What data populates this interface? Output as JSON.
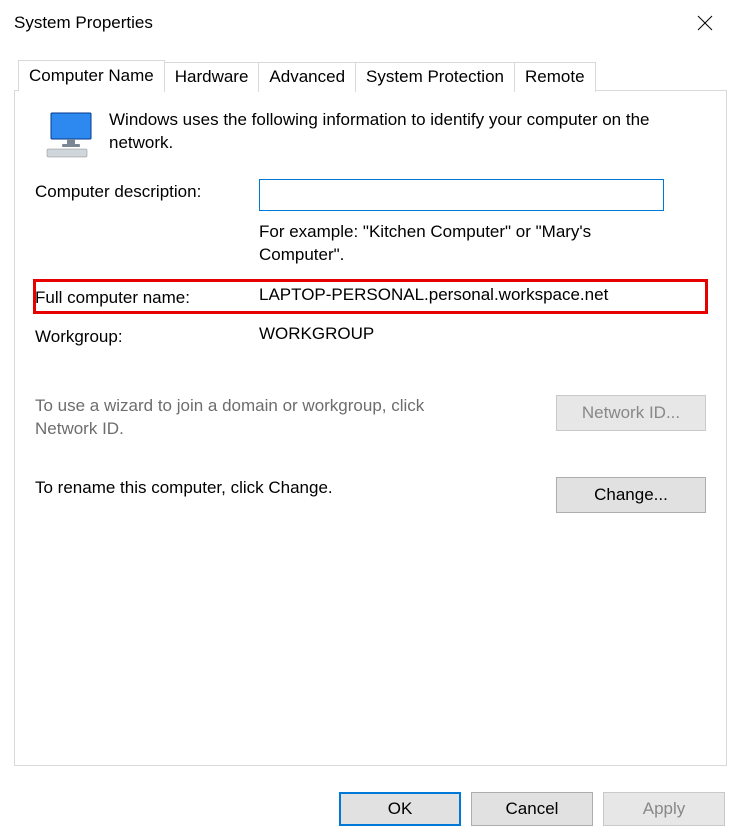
{
  "window": {
    "title": "System Properties"
  },
  "tabs": [
    {
      "label": "Computer Name",
      "active": true
    },
    {
      "label": "Hardware",
      "active": false
    },
    {
      "label": "Advanced",
      "active": false
    },
    {
      "label": "System Protection",
      "active": false
    },
    {
      "label": "Remote",
      "active": false
    }
  ],
  "panel": {
    "intro": "Windows uses the following information to identify your computer on the network.",
    "description_label": "Computer description:",
    "description_value": "",
    "example_text": "For example: \"Kitchen Computer\" or \"Mary's Computer\".",
    "full_name_label": "Full computer name:",
    "full_name_value": "LAPTOP-PERSONAL.personal.workspace.net",
    "workgroup_label": "Workgroup:",
    "workgroup_value": "WORKGROUP",
    "wizard_text": "To use a wizard to join a domain or workgroup, click Network ID.",
    "network_id_label": "Network ID...",
    "rename_text": "To rename this computer, click Change.",
    "change_label": "Change..."
  },
  "footer": {
    "ok": "OK",
    "cancel": "Cancel",
    "apply": "Apply"
  }
}
